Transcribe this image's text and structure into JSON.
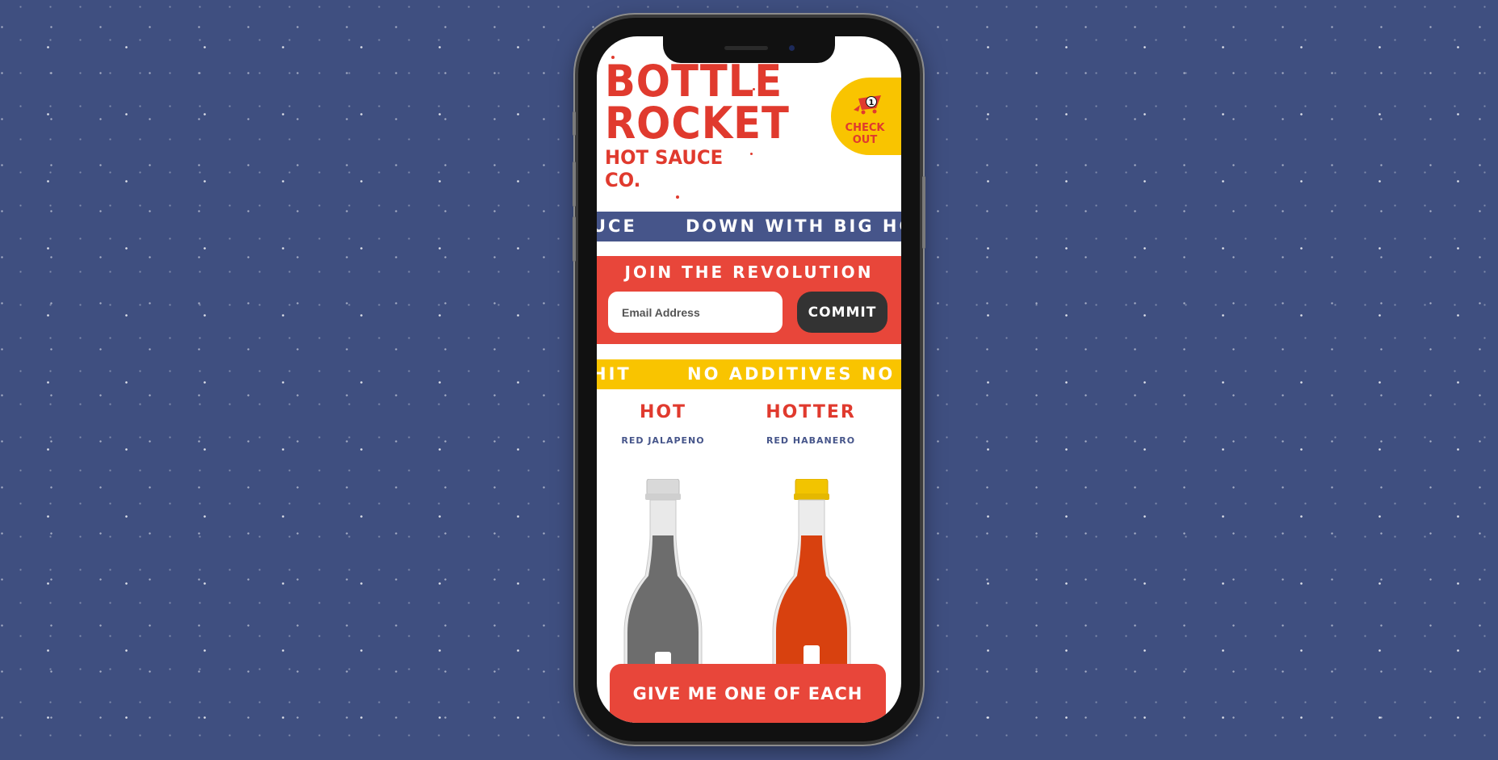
{
  "brand": {
    "line1": "BOTTLE",
    "line2": "ROCKET",
    "line3": "HOT SAUCE CO."
  },
  "cart": {
    "count": "1",
    "label_line1": "CHECK",
    "label_line2": "OUT",
    "icon": "rocket-cart-icon"
  },
  "tickers": {
    "top": {
      "part_left": "UCE",
      "part_right": "DOWN WITH BIG HOT S"
    },
    "bottom": {
      "part_left": "HIT",
      "part_right": "NO ADDITIVES NO BUL"
    }
  },
  "signup": {
    "title": "JOIN THE REVOLUTION",
    "email_placeholder": "Email Address",
    "submit_label": "COMMIT"
  },
  "products": [
    {
      "name": "HOT",
      "variety": "RED JALAPENO"
    },
    {
      "name": "HOTTER",
      "variety": "RED HABANERO"
    }
  ],
  "cta": {
    "label": "GIVE ME ONE OF EACH"
  },
  "colors": {
    "background": "#3f4f80",
    "brand_red": "#e03a2e",
    "accent_yellow": "#f9c400",
    "navy": "#46558a"
  }
}
